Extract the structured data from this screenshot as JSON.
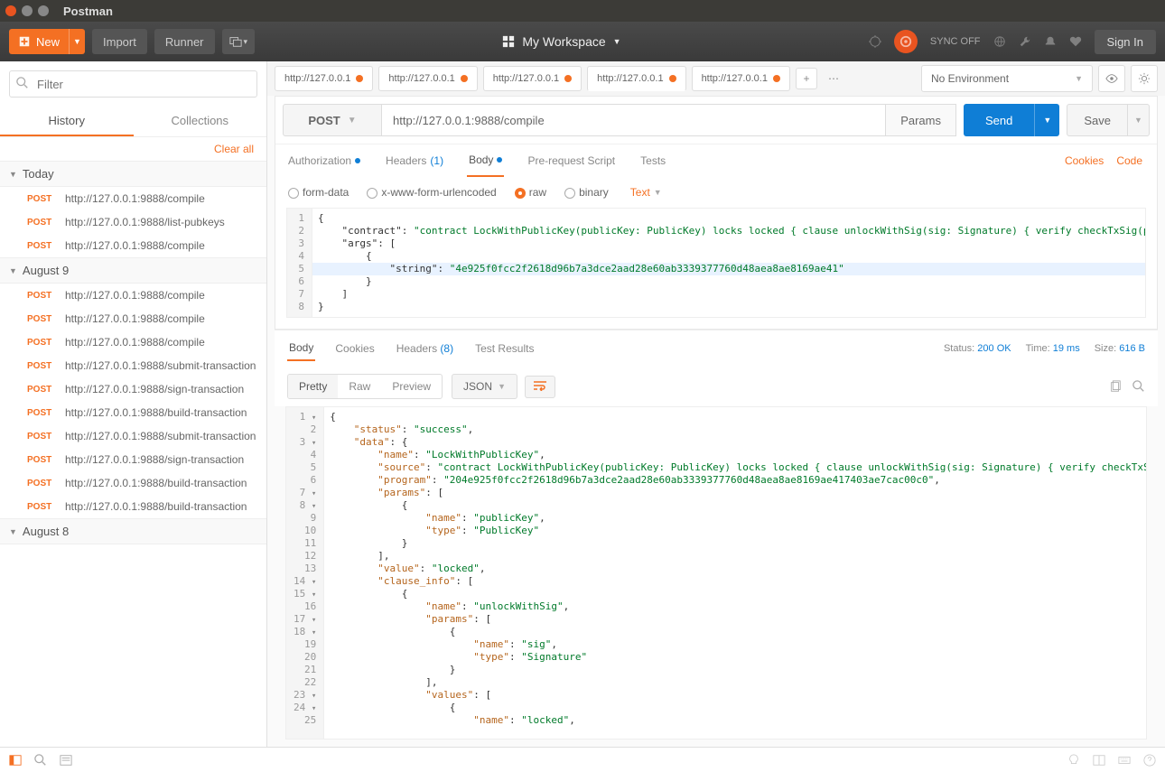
{
  "window": {
    "title": "Postman"
  },
  "toolbar": {
    "new": "New",
    "import": "Import",
    "runner": "Runner",
    "workspace": "My Workspace",
    "sync": "SYNC OFF",
    "signin": "Sign In"
  },
  "sidebar": {
    "filter_placeholder": "Filter",
    "tabs": {
      "history": "History",
      "collections": "Collections"
    },
    "clear_all": "Clear all",
    "groups": [
      {
        "label": "Today",
        "items": [
          {
            "method": "POST",
            "url": "http://127.0.0.1:9888/compile"
          },
          {
            "method": "POST",
            "url": "http://127.0.0.1:9888/list-pubkeys"
          },
          {
            "method": "POST",
            "url": "http://127.0.0.1:9888/compile"
          }
        ]
      },
      {
        "label": "August 9",
        "items": [
          {
            "method": "POST",
            "url": "http://127.0.0.1:9888/compile"
          },
          {
            "method": "POST",
            "url": "http://127.0.0.1:9888/compile"
          },
          {
            "method": "POST",
            "url": "http://127.0.0.1:9888/compile"
          },
          {
            "method": "POST",
            "url": "http://127.0.0.1:9888/submit-transaction"
          },
          {
            "method": "POST",
            "url": "http://127.0.0.1:9888/sign-transaction"
          },
          {
            "method": "POST",
            "url": "http://127.0.0.1:9888/build-transaction"
          },
          {
            "method": "POST",
            "url": "http://127.0.0.1:9888/submit-transaction"
          },
          {
            "method": "POST",
            "url": "http://127.0.0.1:9888/sign-transaction"
          },
          {
            "method": "POST",
            "url": "http://127.0.0.1:9888/build-transaction"
          },
          {
            "method": "POST",
            "url": "http://127.0.0.1:9888/build-transaction"
          }
        ]
      },
      {
        "label": "August 8",
        "items": []
      }
    ]
  },
  "reqTabs": [
    {
      "label": "http://127.0.0.1",
      "dirty": true
    },
    {
      "label": "http://127.0.0.1",
      "dirty": true
    },
    {
      "label": "http://127.0.0.1",
      "dirty": true
    },
    {
      "label": "http://127.0.0.1",
      "dirty": true,
      "active": true
    },
    {
      "label": "http://127.0.0.1",
      "dirty": true
    }
  ],
  "env": {
    "label": "No Environment"
  },
  "request": {
    "method": "POST",
    "url": "http://127.0.0.1:9888/compile",
    "params": "Params",
    "send": "Send",
    "save": "Save",
    "subtabs": {
      "authorization": "Authorization",
      "headers": "Headers",
      "headers_count": "(1)",
      "body": "Body",
      "pre": "Pre-request Script",
      "tests": "Tests"
    },
    "links": {
      "cookies": "Cookies",
      "code": "Code"
    },
    "bodyTypes": {
      "form": "form-data",
      "url": "x-www-form-urlencoded",
      "raw": "raw",
      "binary": "binary"
    },
    "bodyMode": "Text"
  },
  "reqBody": {
    "l1": "{",
    "l2a": "    \"contract\": ",
    "l2b": "\"contract LockWithPublicKey(publicKey: PublicKey) locks locked { clause unlockWithSig(sig: Signature) { verify checkTxSig(publicKey, sig) unlock locked }}\"",
    "l2c": ",",
    "l3": "    \"args\": [",
    "l4": "        {",
    "l5a": "            \"string\": ",
    "l5b": "\"4e925f0fcc2f2618d96b7a3dce2aad28e60ab3339377760d48aea8ae8169ae41\"",
    "l6": "        }",
    "l7": "    ]",
    "l8": "}"
  },
  "response": {
    "tabs": {
      "body": "Body",
      "cookies": "Cookies",
      "headers": "Headers",
      "headers_count": "(8)",
      "tests": "Test Results"
    },
    "meta": {
      "status_l": "Status:",
      "status_v": "200 OK",
      "time_l": "Time:",
      "time_v": "19 ms",
      "size_l": "Size:",
      "size_v": "616 B"
    },
    "view": {
      "pretty": "Pretty",
      "raw": "Raw",
      "preview": "Preview",
      "lang": "JSON"
    }
  },
  "respBody": {
    "lines": [
      "{",
      "    \"status\": \"success\",",
      "    \"data\": {",
      "        \"name\": \"LockWithPublicKey\",",
      "        \"source\": \"contract LockWithPublicKey(publicKey: PublicKey) locks locked { clause unlockWithSig(sig: Signature) { verify checkTxSig(publicKey, sig) unlock locked }}\",",
      "        \"program\": \"204e925f0fcc2f2618d96b7a3dce2aad28e60ab3339377760d48aea8ae8169ae417403ae7cac00c0\",",
      "        \"params\": [",
      "            {",
      "                \"name\": \"publicKey\",",
      "                \"type\": \"PublicKey\"",
      "            }",
      "        ],",
      "        \"value\": \"locked\",",
      "        \"clause_info\": [",
      "            {",
      "                \"name\": \"unlockWithSig\",",
      "                \"params\": [",
      "                    {",
      "                        \"name\": \"sig\",",
      "                        \"type\": \"Signature\"",
      "                    }",
      "                ],",
      "                \"values\": [",
      "                    {",
      "                        \"name\": \"locked\","
    ]
  }
}
